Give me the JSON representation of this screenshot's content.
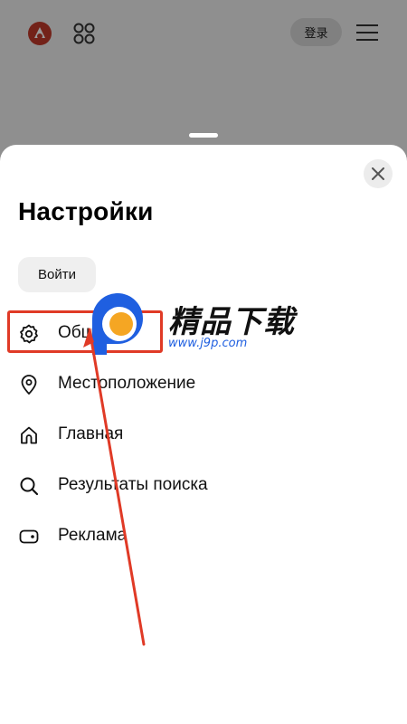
{
  "header": {
    "login_label": "登录",
    "icons": [
      "alice-logo-icon",
      "apps-grid-icon",
      "menu-burger-icon"
    ]
  },
  "settings": {
    "title": "Настройки",
    "signin_label": "Войти",
    "items": [
      {
        "label": "Общие",
        "icon": "gear-icon"
      },
      {
        "label": "Местоположение",
        "icon": "location-pin-icon"
      },
      {
        "label": "Главная",
        "icon": "home-icon"
      },
      {
        "label": "Результаты поиска",
        "icon": "search-icon"
      },
      {
        "label": "Реклама",
        "icon": "ad-tag-icon"
      }
    ]
  },
  "watermark": {
    "brand": "精品下载",
    "url": "www.j9p.com"
  },
  "colors": {
    "accent_red": "#e03a26",
    "watermark_blue": "#1f5fe0",
    "watermark_orange": "#f5a623",
    "logo_red": "#c0392b"
  }
}
